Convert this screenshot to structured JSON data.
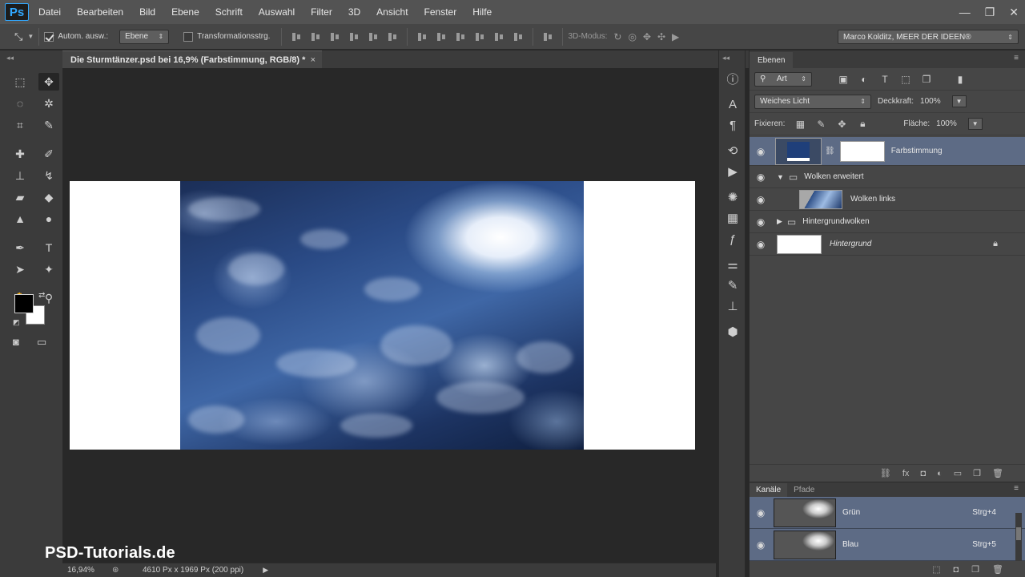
{
  "app": {
    "logo": "Ps"
  },
  "menu": [
    "Datei",
    "Bearbeiten",
    "Bild",
    "Ebene",
    "Schrift",
    "Auswahl",
    "Filter",
    "3D",
    "Ansicht",
    "Fenster",
    "Hilfe"
  ],
  "window_controls": {
    "minimize": "—",
    "restore": "❐",
    "close": "✕"
  },
  "options": {
    "auto_select_label": "Autom. ausw.:",
    "auto_select_checked": true,
    "auto_select_target": "Ebene",
    "transform_label": "Transformationsstrg.",
    "transform_checked": false,
    "mode3d_label": "3D-Modus:",
    "workspace": "Marco Kolditz, MEER DER IDEEN®"
  },
  "document": {
    "tab_title": "Die Sturmtänzer.psd bei 16,9% (Farbstimmung, RGB/8) *",
    "close_glyph": "×"
  },
  "status": {
    "zoom": "16,94%",
    "doc_info": "4610 Px x 1969 Px (200 ppi)"
  },
  "watermark": "PSD-Tutorials.de",
  "layers_panel": {
    "tab": "Ebenen",
    "filter_kind": "Art",
    "blend_mode": "Weiches Licht",
    "opacity_label": "Deckkraft:",
    "opacity_value": "100%",
    "lock_label": "Fixieren:",
    "fill_label": "Fläche:",
    "fill_value": "100%",
    "layers": [
      {
        "name": "Farbstimmung",
        "type": "adjustment",
        "selected": true
      },
      {
        "name": "Wolken erweitert",
        "type": "group-open",
        "selected": false
      },
      {
        "name": "Wolken links",
        "type": "smart",
        "selected": false
      },
      {
        "name": "Hintergrundwolken",
        "type": "group-closed",
        "selected": false
      },
      {
        "name": "Hintergrund",
        "type": "background",
        "locked": true,
        "selected": false
      }
    ]
  },
  "channels_panel": {
    "tabs": [
      "Kanäle",
      "Pfade"
    ],
    "active_tab": "Kanäle",
    "channels": [
      {
        "name": "Grün",
        "shortcut": "Strg+4"
      },
      {
        "name": "Blau",
        "shortcut": "Strg+5"
      }
    ]
  },
  "colors": {
    "foreground": "#000000",
    "background": "#ffffff",
    "selection": "#5d6b85",
    "adjustment_swatch": "#1f3f7a"
  }
}
